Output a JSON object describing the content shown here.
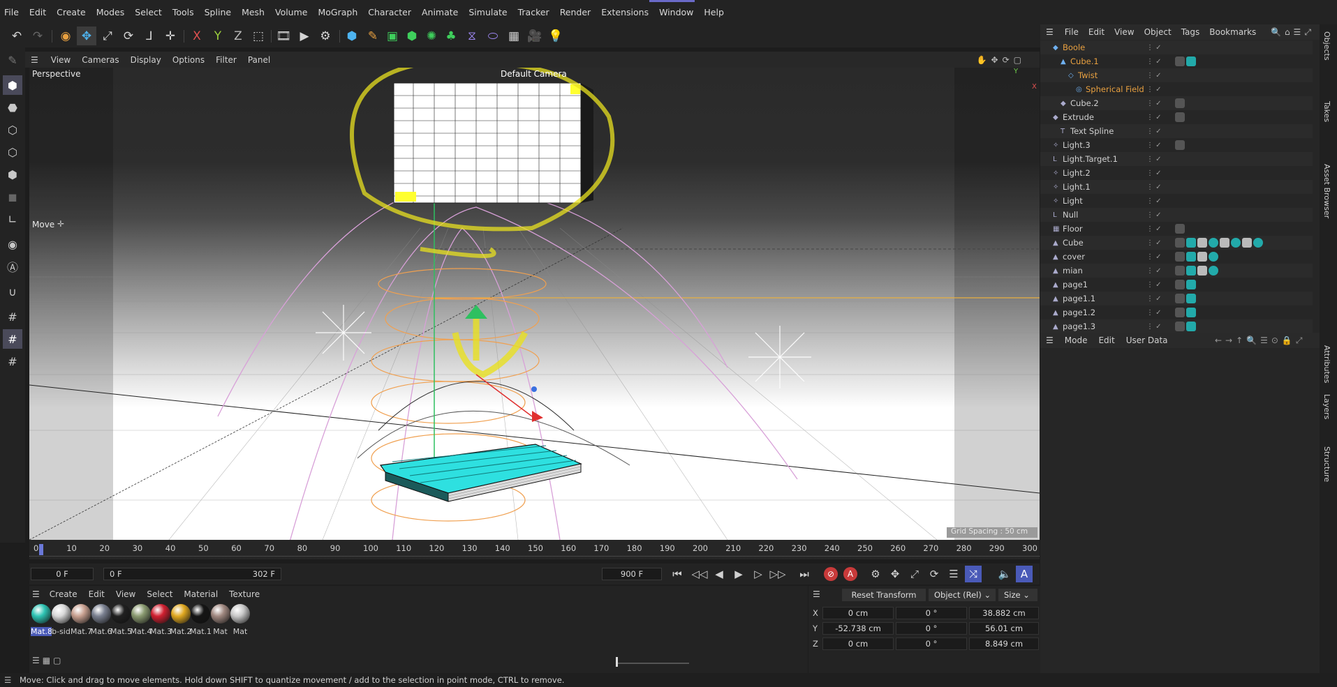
{
  "menubar": [
    "File",
    "Edit",
    "Create",
    "Modes",
    "Select",
    "Tools",
    "Spline",
    "Mesh",
    "Volume",
    "MoGraph",
    "Character",
    "Animate",
    "Simulate",
    "Tracker",
    "Render",
    "Extensions",
    "Window",
    "Help"
  ],
  "viewport_menu": [
    "View",
    "Cameras",
    "Display",
    "Options",
    "Filter",
    "Panel"
  ],
  "viewport": {
    "name": "Perspective",
    "camera": "Default Camera",
    "tool": "Move",
    "grid": "Grid Spacing : 50 cm",
    "axis_x": "X",
    "axis_y": "Y"
  },
  "toolbar_axes": [
    "X",
    "Y",
    "Z"
  ],
  "timeline": {
    "ticks": [
      "0",
      "10",
      "20",
      "30",
      "40",
      "50",
      "60",
      "70",
      "80",
      "90",
      "100",
      "110",
      "120",
      "130",
      "140",
      "150",
      "160",
      "170",
      "180",
      "190",
      "200",
      "210",
      "220",
      "230",
      "240",
      "250",
      "260",
      "270",
      "280",
      "290",
      "300"
    ]
  },
  "transport": {
    "current": "0 F",
    "start": "0 F",
    "end": "302 F",
    "max": "900 F"
  },
  "material_menu": [
    "Create",
    "Edit",
    "View",
    "Select",
    "Material",
    "Texture"
  ],
  "materials": [
    {
      "label": "Mat.8",
      "color": "#2ec4b4",
      "selected": true
    },
    {
      "label": "b-sid",
      "color": "#d8d8d8"
    },
    {
      "label": "Mat.7",
      "color": "#c8a090"
    },
    {
      "label": "Mat.6",
      "color": "#7a8090"
    },
    {
      "label": "Mat.5",
      "color": "#202020"
    },
    {
      "label": "Mat.4",
      "color": "#8a9a70"
    },
    {
      "label": "Mat.3",
      "color": "#d02030"
    },
    {
      "label": "Mat.2",
      "color": "#e0a820"
    },
    {
      "label": "Mat.1",
      "color": "#151515"
    },
    {
      "label": "Mat",
      "color": "#a08880"
    },
    {
      "label": "Mat",
      "color": "#c8c8c8"
    }
  ],
  "coords": {
    "reset": "Reset Transform",
    "mode": "Object (Rel)",
    "size_mode": "Size",
    "rows": [
      {
        "axis": "X",
        "pos": "0 cm",
        "rot": "0 °",
        "size": "38.882 cm"
      },
      {
        "axis": "Y",
        "pos": "-52.738 cm",
        "rot": "0 °",
        "size": "56.01 cm"
      },
      {
        "axis": "Z",
        "pos": "0 cm",
        "rot": "0 °",
        "size": "8.849 cm"
      }
    ]
  },
  "status": "Move: Click and drag to move elements. Hold down SHIFT to quantize movement / add to the selection in point mode, CTRL to remove.",
  "objects_menu": [
    "File",
    "Edit",
    "View",
    "Object",
    "Tags",
    "Bookmarks"
  ],
  "objects": [
    {
      "name": "Boole",
      "indent": 0,
      "color": "#e8a040",
      "icon": "◆"
    },
    {
      "name": "Cube.1",
      "indent": 1,
      "color": "#e8a040",
      "icon": "▲"
    },
    {
      "name": "Twist",
      "indent": 2,
      "color": "#e8a040",
      "icon": "◇"
    },
    {
      "name": "Spherical Field",
      "indent": 3,
      "color": "#e8a040",
      "icon": "◎"
    },
    {
      "name": "Cube.2",
      "indent": 1,
      "color": "#d0d0d0",
      "icon": "◆"
    },
    {
      "name": "Extrude",
      "indent": 0,
      "color": "#d0d0d0",
      "icon": "◆"
    },
    {
      "name": "Text Spline",
      "indent": 1,
      "color": "#d0d0d0",
      "icon": "T"
    },
    {
      "name": "Light.3",
      "indent": 0,
      "color": "#d0d0d0",
      "icon": "✧"
    },
    {
      "name": "Light.Target.1",
      "indent": 0,
      "color": "#d0d0d0",
      "icon": "L"
    },
    {
      "name": "Light.2",
      "indent": 0,
      "color": "#d0d0d0",
      "icon": "✧"
    },
    {
      "name": "Light.1",
      "indent": 0,
      "color": "#d0d0d0",
      "icon": "✧"
    },
    {
      "name": "Light",
      "indent": 0,
      "color": "#d0d0d0",
      "icon": "✧"
    },
    {
      "name": "Null",
      "indent": 0,
      "color": "#d0d0d0",
      "icon": "L"
    },
    {
      "name": "Floor",
      "indent": 0,
      "color": "#d0d0d0",
      "icon": "▦"
    },
    {
      "name": "Cube",
      "indent": 0,
      "color": "#d0d0d0",
      "icon": "▲"
    },
    {
      "name": "cover",
      "indent": 0,
      "color": "#d0d0d0",
      "icon": "▲"
    },
    {
      "name": "mian",
      "indent": 0,
      "color": "#d0d0d0",
      "icon": "▲"
    },
    {
      "name": "page1",
      "indent": 0,
      "color": "#d0d0d0",
      "icon": "▲"
    },
    {
      "name": "page1.1",
      "indent": 0,
      "color": "#d0d0d0",
      "icon": "▲"
    },
    {
      "name": "page1.2",
      "indent": 0,
      "color": "#d0d0d0",
      "icon": "▲"
    },
    {
      "name": "page1.3",
      "indent": 0,
      "color": "#d0d0d0",
      "icon": "▲"
    }
  ],
  "attributes_menu": [
    "Mode",
    "Edit",
    "User Data"
  ],
  "side_tabs": [
    "Objects",
    "Takes",
    "Asset Browser",
    "Attributes",
    "Layers",
    "Structure"
  ]
}
